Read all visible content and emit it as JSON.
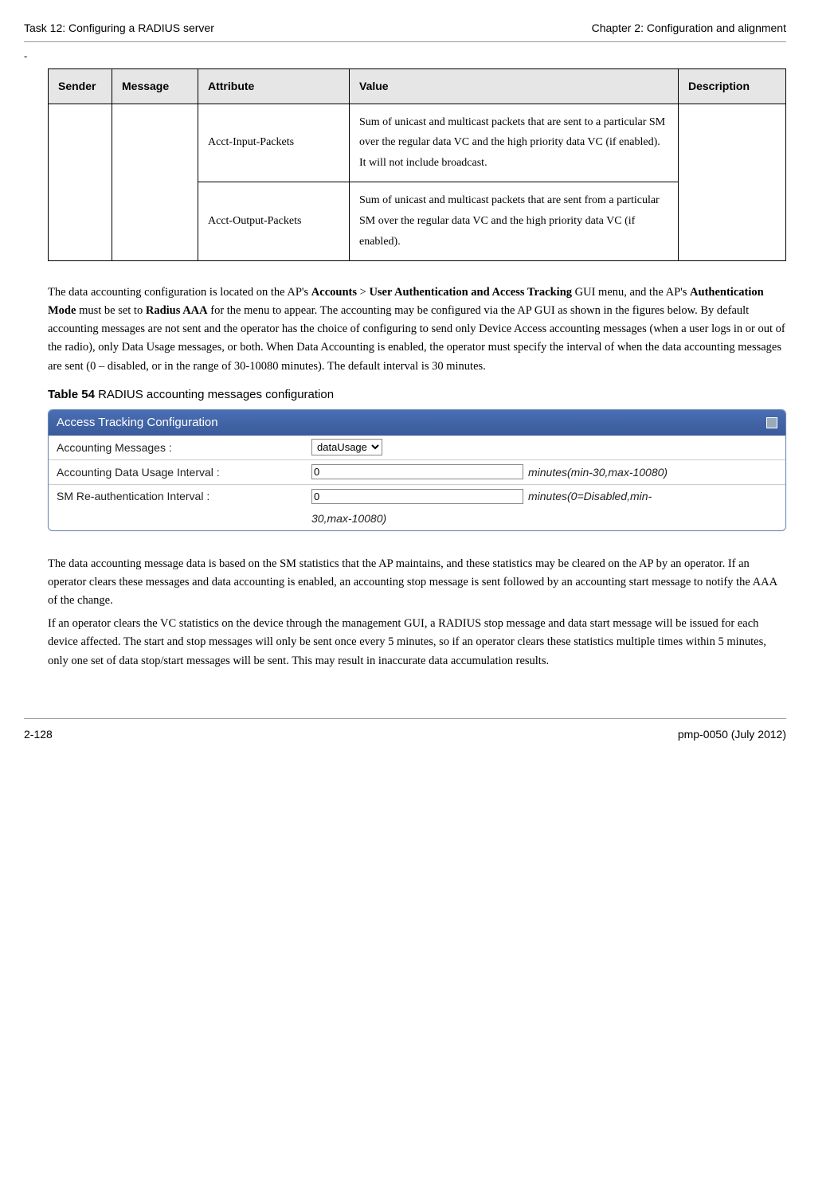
{
  "header": {
    "left": "Task 12: Configuring a RADIUS server",
    "right": "Chapter 2:  Configuration and alignment"
  },
  "dash": "-",
  "table": {
    "headers": {
      "sender": "Sender",
      "message": "Message",
      "attribute": "Attribute",
      "value": "Value",
      "description": "Description"
    },
    "rows": [
      {
        "attribute": "Acct-Input-Packets",
        "value": "Sum of unicast and multicast packets that are sent to a particular SM over the regular data VC and the high priority data VC (if enabled).  It will not include broadcast."
      },
      {
        "attribute": "Acct-Output-Packets",
        "value": "Sum of unicast and multicast packets that are sent from a particular SM over the regular data VC and the high priority data VC (if enabled)."
      }
    ]
  },
  "para1_pre": "The data accounting configuration is located on the AP's ",
  "para1_b1": "Accounts",
  "para1_mid1": " > ",
  "para1_b2": "User Authentication and Access Tracking",
  "para1_mid2": " GUI menu, and the AP's ",
  "para1_b3": "Authentication Mode",
  "para1_mid3": " must be set to ",
  "para1_b4": "Radius AAA",
  "para1_post": " for the menu to appear.  The accounting may be configured via the AP GUI as shown in the figures below.  By default accounting messages are not sent and the operator has the choice of configuring to send only Device Access accounting messages (when a user logs in or out of the radio), only Data Usage messages, or both.  When Data Accounting is enabled, the operator must specify the interval of when the data accounting messages are sent (0 – disabled, or in the range of 30-10080 minutes).  The default interval is 30 minutes.",
  "caption": {
    "bold": "Table 54",
    "rest": "  RADIUS accounting messages configuration"
  },
  "panel": {
    "title": "Access Tracking Configuration",
    "rows": [
      {
        "label": "Accounting Messages :",
        "type": "select",
        "value": "dataUsage",
        "hint": ""
      },
      {
        "label": "Accounting Data Usage Interval :",
        "type": "text",
        "value": "0",
        "hint": "minutes(min-30,max-10080)"
      },
      {
        "label": "SM Re-authentication Interval :",
        "type": "text",
        "value": "0",
        "hint": "minutes(0=Disabled,min-",
        "hint2": "30,max-10080)"
      }
    ]
  },
  "para2": "The data accounting message data is based on the SM statistics that the AP maintains, and these statistics may be cleared on the AP by an operator.  If an operator clears these messages and data accounting is enabled, an accounting stop message is sent followed by an accounting start message to notify the AAA of the change.",
  "para3": "If an operator clears the VC statistics on the device through the management GUI, a RADIUS stop message and data start message will be issued for each device affected.  The start and stop messages will only be sent once every 5 minutes, so if an operator clears these statistics multiple times within 5 minutes, only one set of data stop/start messages will be sent.  This may result in inaccurate data accumulation results.",
  "footer": {
    "left": "2-128",
    "right": "pmp-0050 (July 2012)"
  }
}
